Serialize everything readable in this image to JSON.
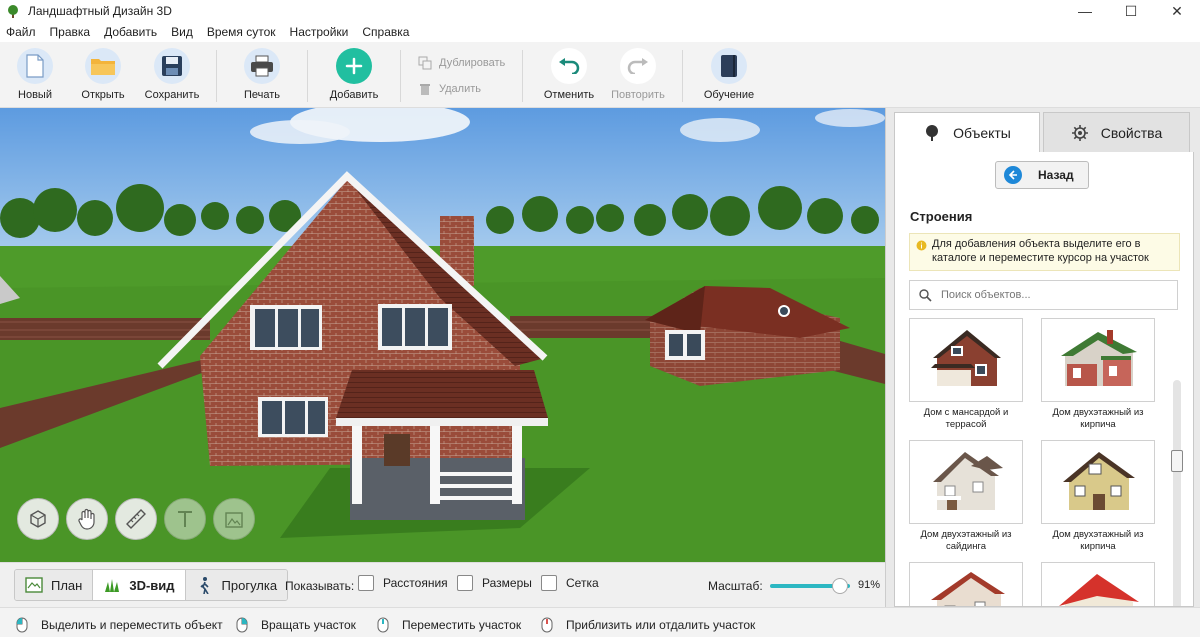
{
  "window": {
    "title": "Ландшафтный Дизайн 3D",
    "controls": {
      "minimize": "—",
      "maximize": "☐",
      "close": "✕"
    }
  },
  "menu": [
    "Файл",
    "Правка",
    "Добавить",
    "Вид",
    "Время суток",
    "Настройки",
    "Справка"
  ],
  "toolbar": {
    "new": "Новый",
    "open": "Открыть",
    "save": "Сохранить",
    "print": "Печать",
    "add": "Добавить",
    "duplicate": "Дублировать",
    "delete": "Удалить",
    "undo": "Отменить",
    "redo": "Повторить",
    "tutorial": "Обучение"
  },
  "view_tools": [
    "select-icon",
    "hand-icon",
    "ruler-icon",
    "text-icon",
    "image-icon"
  ],
  "view_tabs": {
    "plan": "План",
    "view3d": "3D-вид",
    "walk": "Прогулка",
    "active": "3D-вид"
  },
  "show": {
    "label": "Показывать:",
    "distances": "Расстояния",
    "sizes": "Размеры",
    "grid": "Сетка"
  },
  "scale": {
    "label": "Масштаб:",
    "value": "91%"
  },
  "status": {
    "select_move": "Выделить и переместить объект",
    "rotate": "Вращать участок",
    "move": "Переместить участок",
    "zoom": "Приблизить или отдалить участок"
  },
  "panel": {
    "tab_objects": "Объекты",
    "tab_properties": "Свойства",
    "back": "Назад",
    "section": "Строения",
    "hint": "Для добавления объекта выделите его в каталоге и переместите курсор на участок",
    "search_placeholder": "Поиск объектов...",
    "items": [
      {
        "name": "Дом с мансардой и террасой"
      },
      {
        "name": "Дом двухэтажный из кирпича"
      },
      {
        "name": "Дом двухэтажный из сайдинга"
      },
      {
        "name": "Дом двухэтажный из кирпича"
      },
      {
        "name": ""
      },
      {
        "name": ""
      }
    ]
  },
  "colors": {
    "accent": "#2cb7c2",
    "add_button": "#21bfa0",
    "back_button": "#1e88d8",
    "grass": "#4e9b2a",
    "sky": "#7fb3e3"
  }
}
